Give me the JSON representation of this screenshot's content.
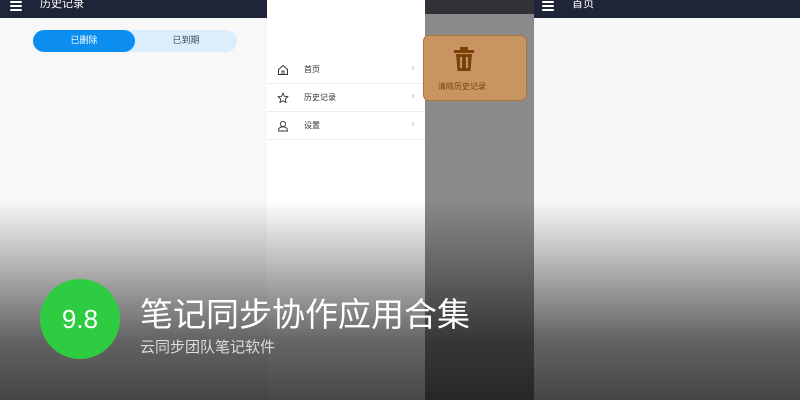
{
  "history_screen": {
    "title": "历史记录",
    "tabs": [
      {
        "label": "已删除",
        "selected": true
      },
      {
        "label": "已到期",
        "selected": false
      }
    ]
  },
  "drawer": {
    "items": [
      {
        "label": "首页",
        "icon": "home-icon"
      },
      {
        "label": "历史记录",
        "icon": "star-icon"
      },
      {
        "label": "设置",
        "icon": "user-icon"
      }
    ],
    "chevron": "›"
  },
  "overlay": {
    "clear_button": {
      "label": "清除历史记录",
      "icon": "trash-icon"
    }
  },
  "home_screen": {
    "title": "首页"
  },
  "banner": {
    "score": "9.8",
    "title": "笔记同步协作应用合集",
    "subtitle": "云同步团队笔记软件"
  },
  "colors": {
    "appbar": "#1e2538",
    "accent_blue": "#0b8ef0",
    "tab_track": "#dcedfd",
    "score_green": "#2ecc40",
    "clear_card": "#c79462",
    "clear_icon": "#7a4208"
  }
}
